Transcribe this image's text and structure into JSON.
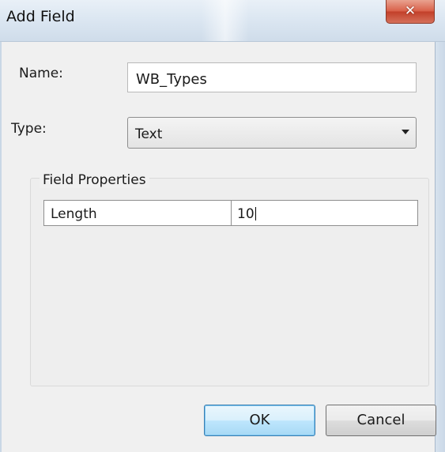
{
  "window": {
    "title": "Add Field",
    "close_glyph": "✕"
  },
  "form": {
    "name_label": "Name:",
    "name_value": "WB_Types",
    "type_label": "Type:",
    "type_value": "Text"
  },
  "field_properties": {
    "group_label": "Field Properties",
    "rows": [
      {
        "key": "Length",
        "value": "10"
      }
    ]
  },
  "buttons": {
    "ok_label": "OK",
    "cancel_label": "Cancel"
  },
  "colors": {
    "close_button": "#d9614a",
    "ok_button_border": "#3c7fb1"
  }
}
